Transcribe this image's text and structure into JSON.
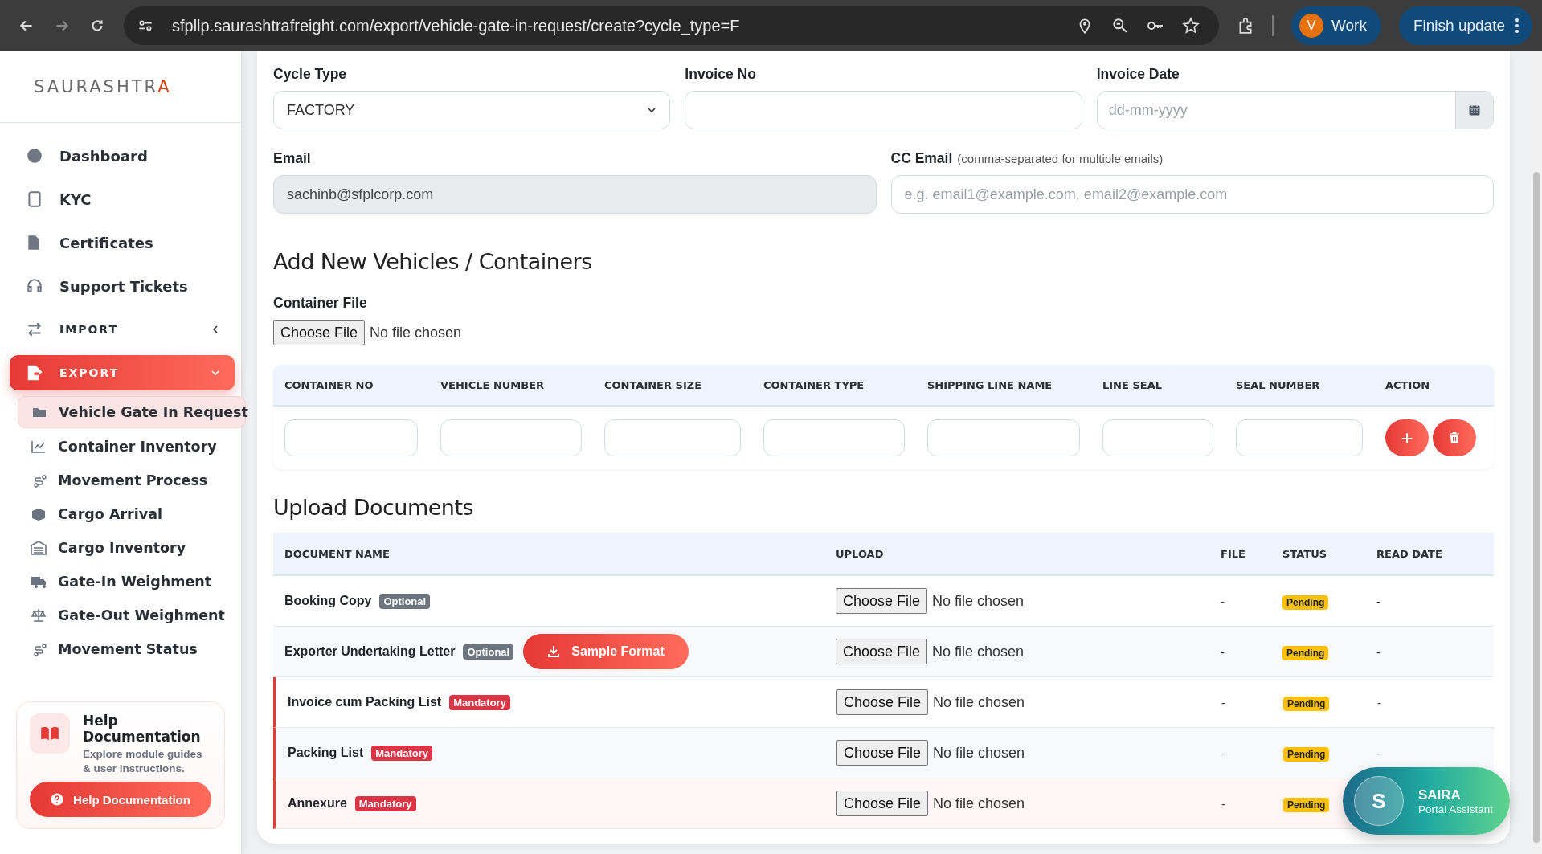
{
  "browser": {
    "url": "sfpllp.saurashtrafreight.com/export/vehicle-gate-in-request/create?cycle_type=F",
    "profile_initial": "V",
    "profile_name": "Work",
    "update_label": "Finish update"
  },
  "sidebar": {
    "logo": "SAURASHTRA",
    "items": [
      {
        "label": "Dashboard",
        "kind": "link"
      },
      {
        "label": "KYC",
        "kind": "link"
      },
      {
        "label": "Certificates",
        "kind": "link"
      },
      {
        "label": "Support Tickets",
        "kind": "link"
      },
      {
        "label": "IMPORT",
        "kind": "section",
        "expanded": false,
        "selected": false
      },
      {
        "label": "EXPORT",
        "kind": "section",
        "expanded": true,
        "selected": true,
        "children": [
          {
            "label": "Vehicle Gate In Request",
            "selected": true
          },
          {
            "label": "Container Inventory",
            "selected": false
          },
          {
            "label": "Movement Process",
            "selected": false
          },
          {
            "label": "Cargo Arrival",
            "selected": false
          },
          {
            "label": "Cargo Inventory",
            "selected": false
          },
          {
            "label": "Gate-In Weighment",
            "selected": false
          },
          {
            "label": "Gate-Out Weighment",
            "selected": false
          },
          {
            "label": "Movement Status",
            "selected": false
          }
        ]
      }
    ],
    "help": {
      "title": "Help Documentation",
      "text": "Explore module guides & user instructions.",
      "button": "Help Documentation"
    }
  },
  "form": {
    "cycle_type": {
      "label": "Cycle Type",
      "value": "FACTORY"
    },
    "invoice_no": {
      "label": "Invoice No"
    },
    "invoice_date": {
      "label": "Invoice Date",
      "placeholder": "dd-mm-yyyy"
    },
    "email": {
      "label": "Email",
      "value": "sachinb@sfplcorp.com",
      "disabled": true
    },
    "cc_email": {
      "label": "CC Email",
      "hint": "(comma-separated for multiple emails)",
      "placeholder": "e.g. email1@example.com, email2@example.com"
    }
  },
  "vehicles": {
    "title": "Add New Vehicles / Containers",
    "file_label": "Container File",
    "file_button": "Choose File",
    "file_status": "No file chosen",
    "columns": [
      "CONTAINER NO",
      "VEHICLE NUMBER",
      "CONTAINER SIZE",
      "CONTAINER TYPE",
      "SHIPPING LINE NAME",
      "LINE SEAL",
      "SEAL NUMBER",
      "ACTION"
    ],
    "add_button": "+"
  },
  "documents": {
    "title": "Upload Documents",
    "columns": [
      "DOCUMENT NAME",
      "UPLOAD",
      "FILE",
      "STATUS",
      "READ DATE"
    ],
    "rows": [
      {
        "name": "Booking Copy",
        "kind": "optional",
        "tag": "Optional",
        "file_button": "Choose File",
        "file_status": "No file chosen",
        "file": "-",
        "status": "Pending",
        "read_date": "-"
      },
      {
        "name": "Exporter Undertaking Letter",
        "kind": "optional",
        "tag": "Optional",
        "sample": "Sample Format",
        "file_button": "Choose File",
        "file_status": "No file chosen",
        "file": "-",
        "status": "Pending",
        "read_date": "-"
      },
      {
        "name": "Invoice cum Packing List",
        "kind": "mandatory",
        "tag": "Mandatory",
        "file_button": "Choose File",
        "file_status": "No file chosen",
        "file": "-",
        "status": "Pending",
        "read_date": "-"
      },
      {
        "name": "Packing List",
        "kind": "mandatory",
        "tag": "Mandatory",
        "file_button": "Choose File",
        "file_status": "No file chosen",
        "file": "-",
        "status": "Pending",
        "read_date": "-"
      },
      {
        "name": "Annexure",
        "kind": "mandatory",
        "tag": "Mandatory",
        "file_button": "Choose File",
        "file_status": "No file chosen",
        "file": "-",
        "status": "Pending"
      }
    ]
  },
  "assistant": {
    "initial": "S",
    "name": "SAIRA",
    "subtitle": "Portal Assistant"
  }
}
